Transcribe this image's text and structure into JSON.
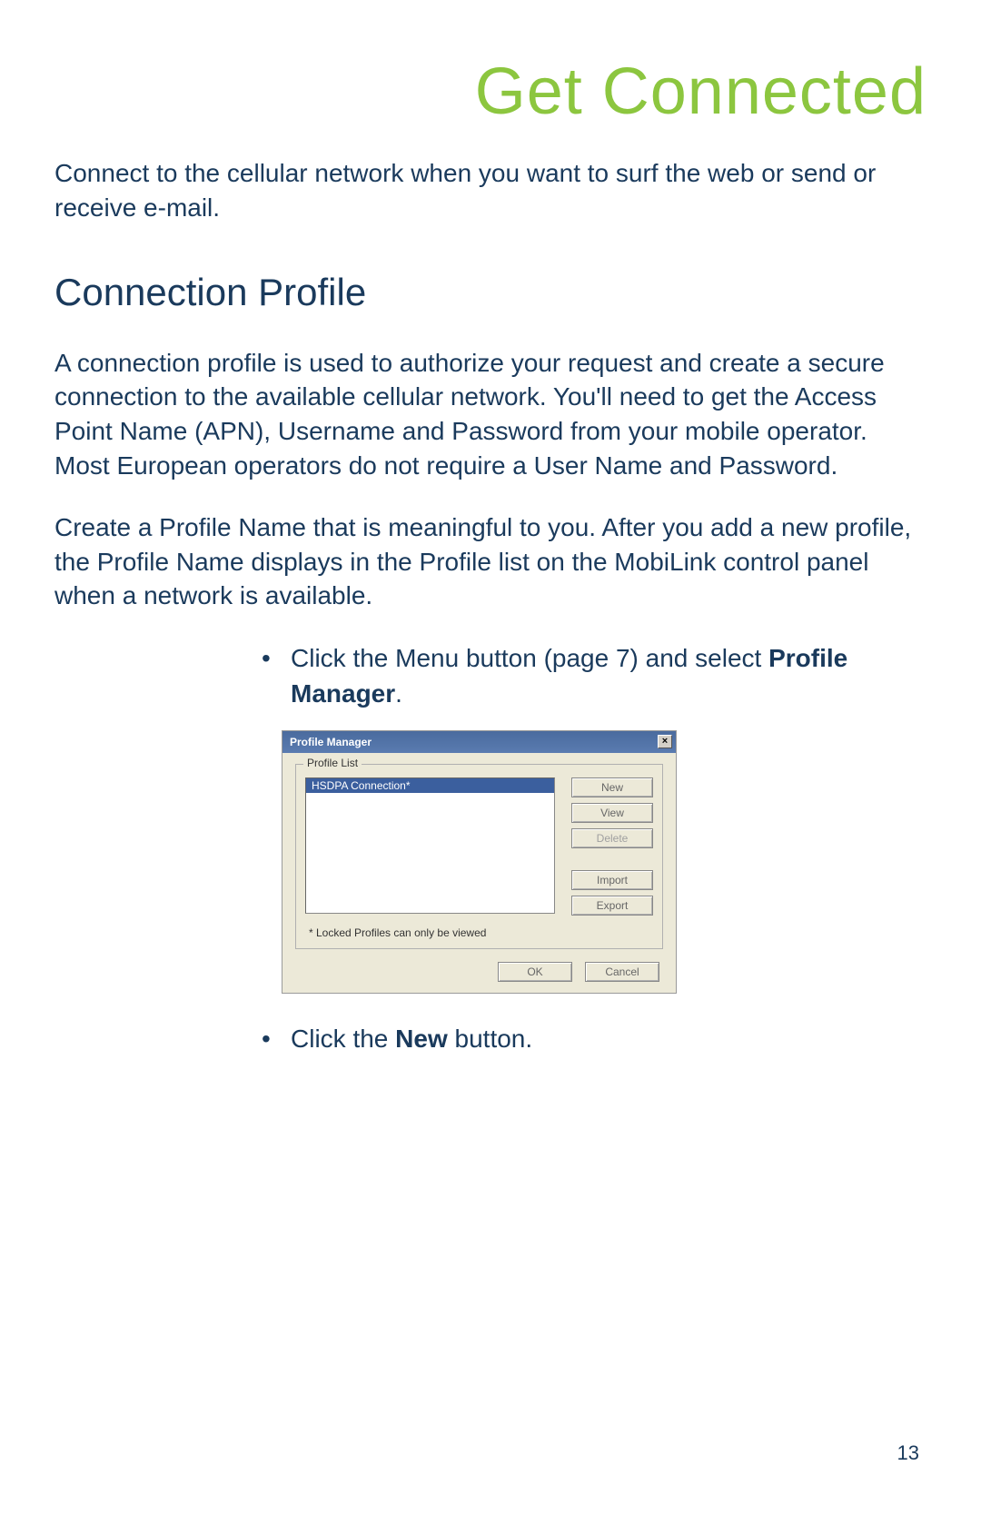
{
  "title": "Get Connected",
  "intro": "Connect to the cellular network when you want to surf the web or send or receive e-mail.",
  "section_heading": "Connection Profile",
  "para1": "A connection profile is used to authorize your request and create a secure connection to the available cellular network. You'll need to get the Access Point Name (APN), Username and Password from your mobile operator. Most European operators do not require a User Name and Password.",
  "para2": "Create a Profile Name that is meaningful to you. After you add a new profile, the Profile Name displays in the Profile list on the MobiLink control panel when a network is available.",
  "bullet1_pre": "Click the Menu button (page 7) and select ",
  "bullet1_bold": "Profile Manager",
  "bullet1_post": ".",
  "bullet2_pre": "Click the ",
  "bullet2_bold": "New",
  "bullet2_post": " button.",
  "dialog": {
    "title": "Profile Manager",
    "close": "×",
    "group_label": "Profile List",
    "list_item": "HSDPA Connection*",
    "buttons": {
      "new": "New",
      "view": "View",
      "delete": "Delete",
      "import": "Import",
      "export": "Export",
      "ok": "OK",
      "cancel": "Cancel"
    },
    "footnote": "* Locked Profiles can only be viewed"
  },
  "page_number": "13"
}
